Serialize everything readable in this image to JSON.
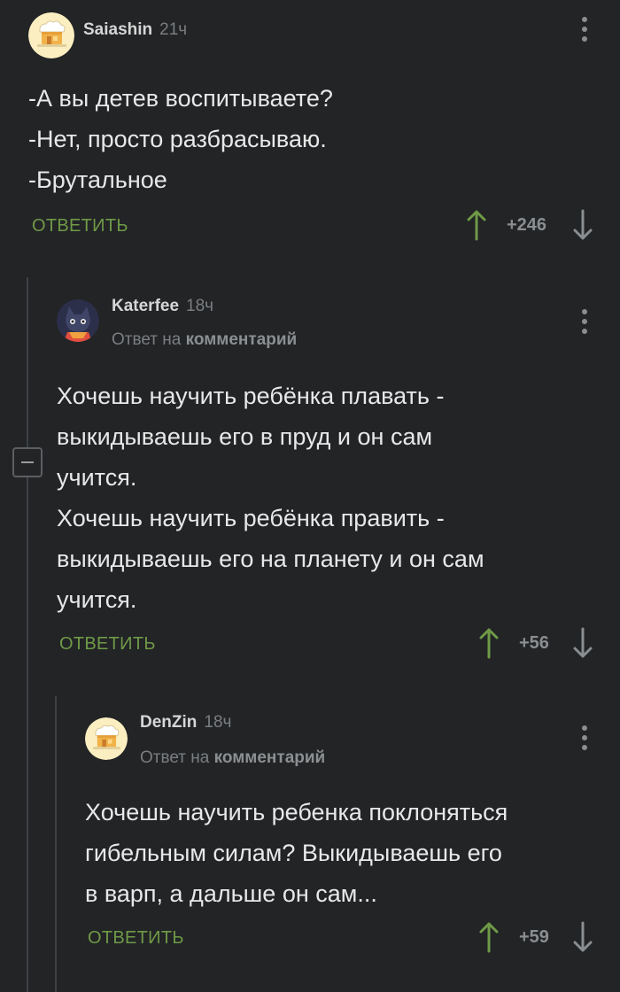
{
  "comments": [
    {
      "author": "Saiashin",
      "time": "21ч",
      "reply_prefix": "",
      "reply_target": "",
      "lines": [
        "-А вы детев воспитываете?",
        "-Нет, просто разбрасываю.",
        "-Брутальное"
      ],
      "reply_label": "ОТВЕТИТЬ",
      "score": "+246",
      "avatar": "chef-hat-avatar"
    },
    {
      "author": "Katerfee",
      "time": "18ч",
      "reply_prefix": "Ответ на",
      "reply_target": "комментарий",
      "lines": [
        "Хочешь научить ребёнка плавать -",
        "выкидываешь его в пруд и он сам",
        "учится.",
        "Хочешь научить ребёнка править -",
        "выкидываешь его на планету и он сам",
        "учится."
      ],
      "reply_label": "ОТВЕТИТЬ",
      "score": "+56",
      "avatar": "cat-character-avatar"
    },
    {
      "author": "DenZin",
      "time": "18ч",
      "reply_prefix": "Ответ на",
      "reply_target": "комментарий",
      "lines": [
        "Хочешь научить ребенка поклоняться",
        "гибельным силам? Выкидываешь его",
        "в варп, а дальше он сам..."
      ],
      "reply_label": "ОТВЕТИТЬ",
      "score": "+59",
      "avatar": "chef-hat-avatar"
    }
  ],
  "icons": {
    "upvote": "arrow-up-icon",
    "downvote": "arrow-down-icon",
    "menu": "kebab-menu-icon",
    "collapse": "minus-collapse-icon"
  },
  "colors": {
    "background": "#222426",
    "accent": "#6f9a47",
    "muted": "#7b7e80",
    "text": "#e8e8e8"
  }
}
